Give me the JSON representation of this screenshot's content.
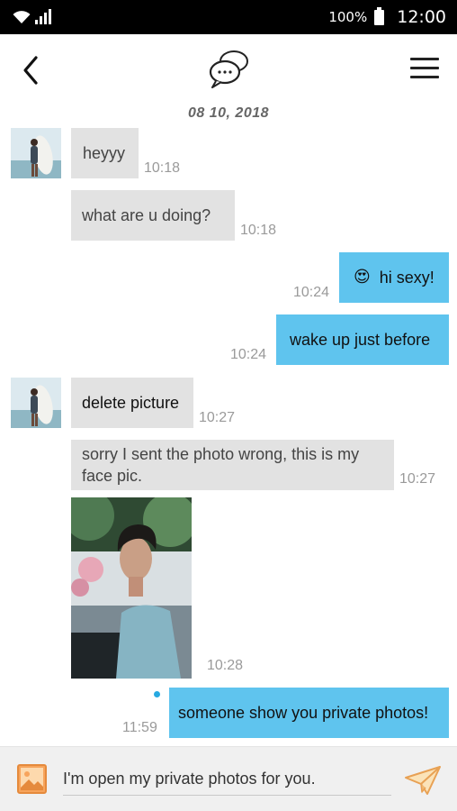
{
  "status_bar": {
    "battery": "100%",
    "time": "12:00"
  },
  "header": {
    "back_icon": "back-arrow-icon",
    "logo_icon": "chat-bubbles-icon",
    "menu_icon": "hamburger-menu-icon"
  },
  "conversation": {
    "date": "08 10, 2018",
    "messages": [
      {
        "direction": "in",
        "text": "heyyy",
        "time": "10:18"
      },
      {
        "direction": "in",
        "text": "what are u doing?",
        "time": "10:18"
      },
      {
        "direction": "out",
        "emoji": "😍",
        "text": "hi sexy!",
        "time": "10:24"
      },
      {
        "direction": "out",
        "text": "wake up just before",
        "time": "10:24"
      },
      {
        "direction": "in",
        "text": "delete picture",
        "time": "10:27"
      },
      {
        "direction": "in",
        "text": "sorry I sent the photo wrong, this is my face pic.",
        "time": "10:27"
      },
      {
        "direction": "in",
        "type": "photo",
        "time": "10:28"
      },
      {
        "direction": "out",
        "text": "someone show you private photos!",
        "time": "11:59"
      }
    ]
  },
  "composer": {
    "value": "I'm open my private photos for you.",
    "gallery_icon": "image-icon",
    "send_icon": "paper-plane-icon"
  },
  "colors": {
    "incoming_bubble": "#e2e2e2",
    "outgoing_bubble": "#5fc4ee",
    "status_bar": "#000000",
    "unread_dot": "#27a9e1"
  }
}
